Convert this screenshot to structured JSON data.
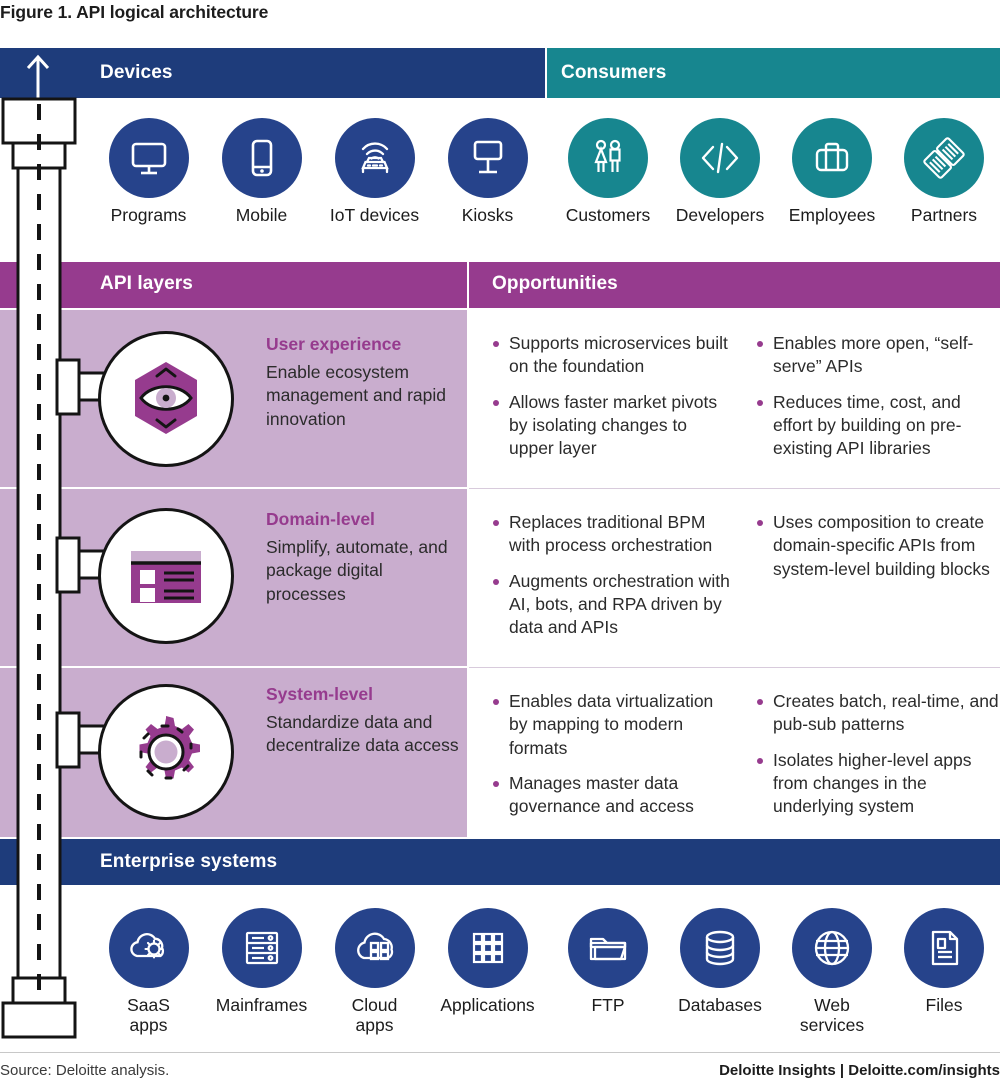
{
  "title": "Figure 1. API logical architecture",
  "colors": {
    "navy": "#1E3C7B",
    "blue_icon": "#26438B",
    "teal": "#17868F",
    "magenta": "#963B8E",
    "lilac": "#C9ADCE",
    "lilac_light": "#CBB0D0"
  },
  "bands": {
    "devices": "Devices",
    "consumers": "Consumers",
    "api_layers": "API layers",
    "opportunities": "Opportunities",
    "enterprise_systems": "Enterprise systems"
  },
  "devices": [
    {
      "icon": "monitor-icon",
      "label": "Programs"
    },
    {
      "icon": "mobile-phone-icon",
      "label": "Mobile"
    },
    {
      "icon": "connected-car-icon",
      "label": "IoT devices"
    },
    {
      "icon": "kiosk-icon",
      "label": "Kiosks"
    }
  ],
  "consumers": [
    {
      "icon": "people-icon",
      "label": "Customers"
    },
    {
      "icon": "code-tags-icon",
      "label": "Developers"
    },
    {
      "icon": "briefcase-icon",
      "label": "Employees"
    },
    {
      "icon": "handshake-icon",
      "label": "Partners"
    }
  ],
  "api_layers": [
    {
      "icon": "eye-hexagon-icon",
      "title": "User experience",
      "description": "Enable ecosystem management and rapid innovation",
      "opportunities_left": [
        "Supports microservices built on the foundation",
        "Allows faster market pivots by isolating changes to upper layer"
      ],
      "opportunities_right": [
        "Enables more open, “self-serve” APIs",
        "Reduces time, cost, and effort by building on pre-existing API libraries"
      ]
    },
    {
      "icon": "form-panel-icon",
      "title": "Domain-level",
      "description": "Simplify, automate, and package digital processes",
      "opportunities_left": [
        "Replaces traditional BPM with process orchestration",
        "Augments orchestration with AI, bots, and RPA driven by data and APIs"
      ],
      "opportunities_right": [
        "Uses composition to create domain-specific APIs from system-level building blocks"
      ]
    },
    {
      "icon": "gear-icon",
      "title": "System-level",
      "description": "Standardize data and decentralize data access",
      "opportunities_left": [
        "Enables data virtualization by mapping to modern formats",
        "Manages master data governance and access"
      ],
      "opportunities_right": [
        "Creates batch, real-time, and pub-sub patterns",
        "Isolates higher-level apps from changes in the underlying system"
      ]
    }
  ],
  "enterprise_systems": [
    {
      "icon": "cloud-gear-icon",
      "label": "SaaS\napps"
    },
    {
      "icon": "server-rack-icon",
      "label": "Mainframes"
    },
    {
      "icon": "cloud-apps-icon",
      "label": "Cloud\napps"
    },
    {
      "icon": "grid-apps-icon",
      "label": "Applications"
    },
    {
      "icon": "folder-icon",
      "label": "FTP"
    },
    {
      "icon": "database-icon",
      "label": "Databases"
    },
    {
      "icon": "globe-icon",
      "label": "Web\nservices"
    },
    {
      "icon": "document-icon",
      "label": "Files"
    }
  ],
  "footer": {
    "source": "Source: Deloitte analysis.",
    "brand": "Deloitte Insights | Deloitte.com/insights"
  }
}
